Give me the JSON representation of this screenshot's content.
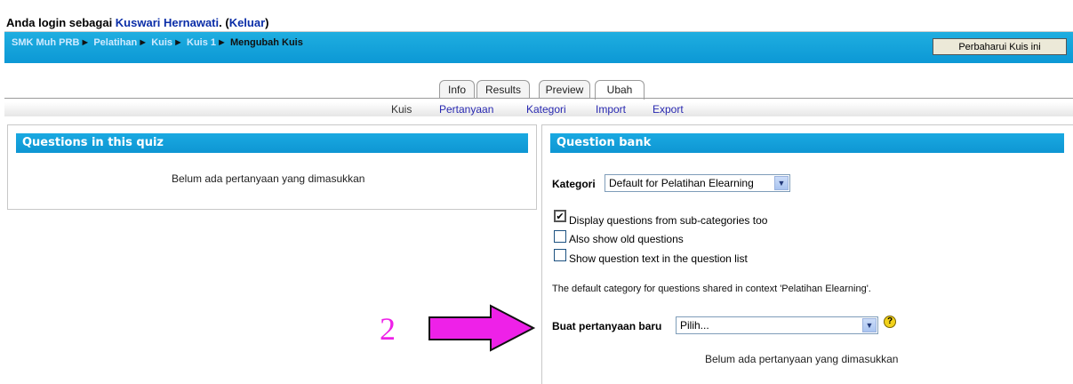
{
  "login": {
    "prefix": "Anda login sebagai ",
    "user": "Kuswari Hernawati",
    "dot": ". (",
    "logout": "Keluar",
    "suffix": ")"
  },
  "breadcrumb": {
    "items": [
      "SMK Muh PRB",
      "Pelatihan",
      "Kuis",
      "Kuis 1"
    ],
    "current": "Mengubah Kuis",
    "separator": "►"
  },
  "update_button": "Perbaharui Kuis ini",
  "tabs": [
    "Info",
    "Results",
    "Preview",
    "Ubah"
  ],
  "active_tab": "Ubah",
  "subtabs": [
    "Kuis",
    "Pertanyaan",
    "Kategori",
    "Import",
    "Export"
  ],
  "left_panel": {
    "title": "Questions in this quiz",
    "empty": "Belum ada pertanyaan yang dimasukkan"
  },
  "right_panel": {
    "title": "Question bank",
    "kategori_label": "Kategori",
    "kategori_value": "Default for Pelatihan Elearning",
    "options": [
      {
        "label": "Display questions from sub-categories too",
        "checked": true
      },
      {
        "label": "Also show old questions",
        "checked": false
      },
      {
        "label": "Show question text in the question list",
        "checked": false
      }
    ],
    "note": "The default category for questions shared in context 'Pelatihan Elearning'.",
    "buat_label": "Buat pertanyaan baru",
    "buat_value": "Pilih...",
    "empty": "Belum ada pertanyaan yang dimasukkan"
  },
  "annotation": {
    "number": "2",
    "color": "#ee21e8"
  }
}
